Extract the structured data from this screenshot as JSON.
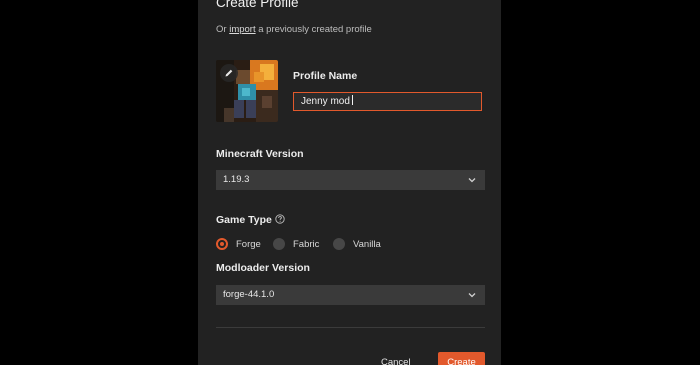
{
  "dialog": {
    "title": "Create Profile",
    "subtitle_prefix": "Or ",
    "subtitle_link": "import",
    "subtitle_suffix": " a previously created profile"
  },
  "profile": {
    "icon_edit": "pencil-icon",
    "name_label": "Profile Name",
    "name_value": "Jenny mod"
  },
  "minecraft_version": {
    "label": "Minecraft Version",
    "selected": "1.19.3"
  },
  "game_type": {
    "label": "Game Type",
    "help_icon": "question-circle-icon",
    "options": [
      {
        "label": "Forge",
        "selected": true
      },
      {
        "label": "Fabric",
        "selected": false
      },
      {
        "label": "Vanilla",
        "selected": false
      }
    ]
  },
  "modloader_version": {
    "label": "Modloader Version",
    "selected": "forge-44.1.0"
  },
  "actions": {
    "cancel_label": "Cancel",
    "create_label": "Create"
  },
  "colors": {
    "accent": "#e2592c",
    "dialog_bg": "#222222",
    "field_bg": "#3a3a3a",
    "backdrop": "#000000"
  }
}
